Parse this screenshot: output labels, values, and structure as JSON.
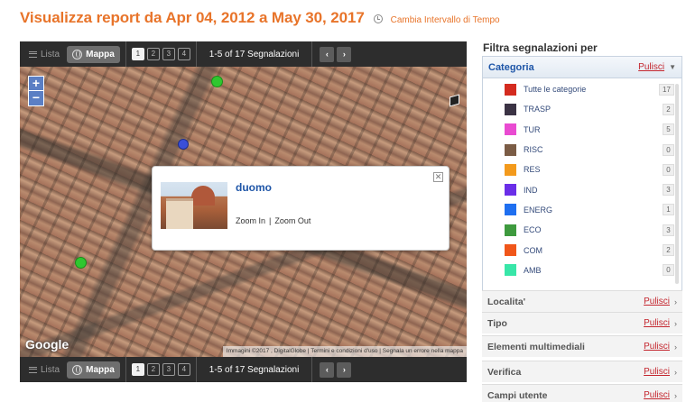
{
  "header": {
    "title": "Visualizza report da Apr 04, 2012 a May 30, 2017",
    "change_range": "Cambia Intervallo di Tempo"
  },
  "toolbar": {
    "lista_label": "Lista",
    "mappa_label": "Mappa",
    "pages": [
      "1",
      "2",
      "3",
      "4"
    ],
    "active_page": "1",
    "count_text": "1-5 of 17 Segnalazioni",
    "prev_arrow": "‹",
    "next_arrow": "›"
  },
  "map": {
    "zoom_in": "+",
    "zoom_out": "−",
    "popup": {
      "title": "duomo",
      "zoom_in": "Zoom In",
      "separator": "|",
      "zoom_out": "Zoom Out",
      "close": "✕"
    },
    "google_logo": "Google",
    "credits": "Immagini ©2017 , DigitalGlobe | Termini e condizioni d'uso | Segnala un errore nella mappa"
  },
  "sidebar": {
    "title": "Filtra segnalazioni per",
    "category_header": "Categoria",
    "clear_label": "Pulisci",
    "categories": [
      {
        "label": "Tutte le categorie",
        "count": "17",
        "color": "#d42b1f"
      },
      {
        "label": "TRASP",
        "count": "2",
        "color": "#3b3344"
      },
      {
        "label": "TUR",
        "count": "5",
        "color": "#e94bd1"
      },
      {
        "label": "RISC",
        "count": "0",
        "color": "#7b5c45"
      },
      {
        "label": "RES",
        "count": "0",
        "color": "#f39a1c"
      },
      {
        "label": "IND",
        "count": "3",
        "color": "#6a2ee8"
      },
      {
        "label": "ENERG",
        "count": "1",
        "color": "#1f6ff0"
      },
      {
        "label": "ECO",
        "count": "3",
        "color": "#3e9a3e"
      },
      {
        "label": "COM",
        "count": "2",
        "color": "#f0561a"
      },
      {
        "label": "AMB",
        "count": "0",
        "color": "#38e6a8"
      }
    ],
    "sections": [
      {
        "name": "Localita'",
        "clear": "Pulisci"
      },
      {
        "name": "Tipo",
        "clear": "Pulisci"
      },
      {
        "name": "Elementi multimediali",
        "clear": "Pulisci"
      },
      {
        "name": "Verifica",
        "clear": "Pulisci"
      },
      {
        "name": "Campi utente",
        "clear": "Pulisci"
      }
    ]
  }
}
